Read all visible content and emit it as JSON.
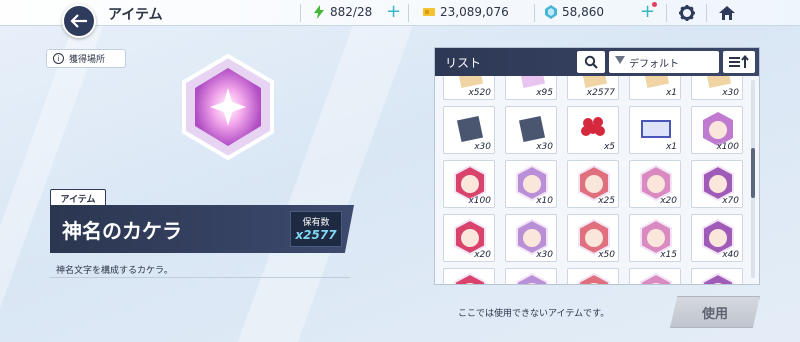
{
  "header": {
    "title": "アイテム",
    "stamina": "882/28",
    "gold": "23,089,076",
    "gems": "58,860"
  },
  "source_button": {
    "label": "獲得場所"
  },
  "item": {
    "category": "アイテム",
    "name": "神名のカケラ",
    "owned_label": "保有数",
    "owned_count": "x2577",
    "description": "神名文字を構成するカケラ。"
  },
  "list": {
    "title": "リスト",
    "sort_label": "デフォルト",
    "rows": [
      [
        "x520",
        "x95",
        "x2577",
        "x1",
        "x30"
      ],
      [
        "x30",
        "x30",
        "x5",
        "x1",
        "x100"
      ],
      [
        "x100",
        "x10",
        "x25",
        "x20",
        "x70"
      ],
      [
        "x20",
        "x30",
        "x50",
        "x15",
        "x40"
      ],
      [
        "",
        "",
        "",
        "",
        ""
      ]
    ]
  },
  "footer": {
    "note": "ここでは使用できないアイテムです。",
    "use_button": "使用"
  },
  "colors": {
    "accent": "#2f3b5c",
    "teal": "#37b6c8",
    "badge_red": "#e0405a"
  }
}
